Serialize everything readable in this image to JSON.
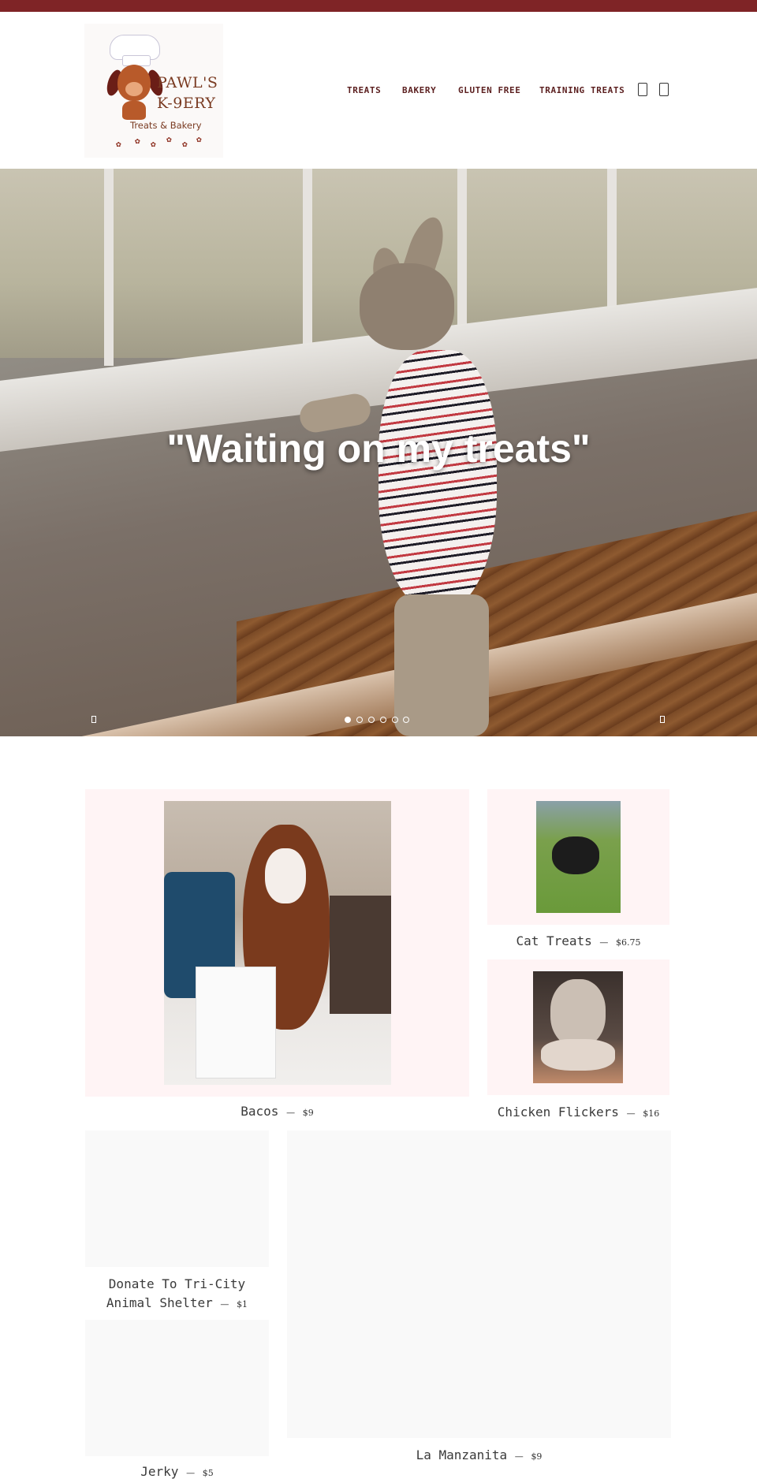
{
  "brand": {
    "name_line1": "PAWL'S",
    "name_line2": "K-9ERY",
    "tagline": "Treats & Bakery"
  },
  "nav": {
    "items": [
      {
        "label": "TREATS"
      },
      {
        "label": "BAKERY"
      },
      {
        "label": "GLUTEN FREE"
      },
      {
        "label": "TRAINING TREATS"
      }
    ],
    "search_icon": "search-icon",
    "cart_icon": "cart-icon"
  },
  "hero": {
    "caption": "\"Waiting on my treats\"",
    "slide_count": 6,
    "active_slide": 1,
    "prev_icon": "chevron-left-icon",
    "next_icon": "chevron-right-icon"
  },
  "products": [
    {
      "name": "Bacos",
      "price": "$9",
      "separator": "—"
    },
    {
      "name": "Cat Treats",
      "price": "$6.75",
      "separator": "—"
    },
    {
      "name": "Chicken Flickers",
      "price": "$16",
      "separator": "—"
    },
    {
      "name": "Donate To Tri-City Animal Shelter",
      "price": "$1",
      "separator": "—"
    },
    {
      "name": "Jerky",
      "price": "$5",
      "separator": "—"
    },
    {
      "name": "La Manzanita",
      "price": "$9",
      "separator": "—"
    }
  ],
  "colors": {
    "topbar": "#7f2426",
    "nav_text": "#5b1f1f",
    "card_bg": "#fff4f5"
  }
}
